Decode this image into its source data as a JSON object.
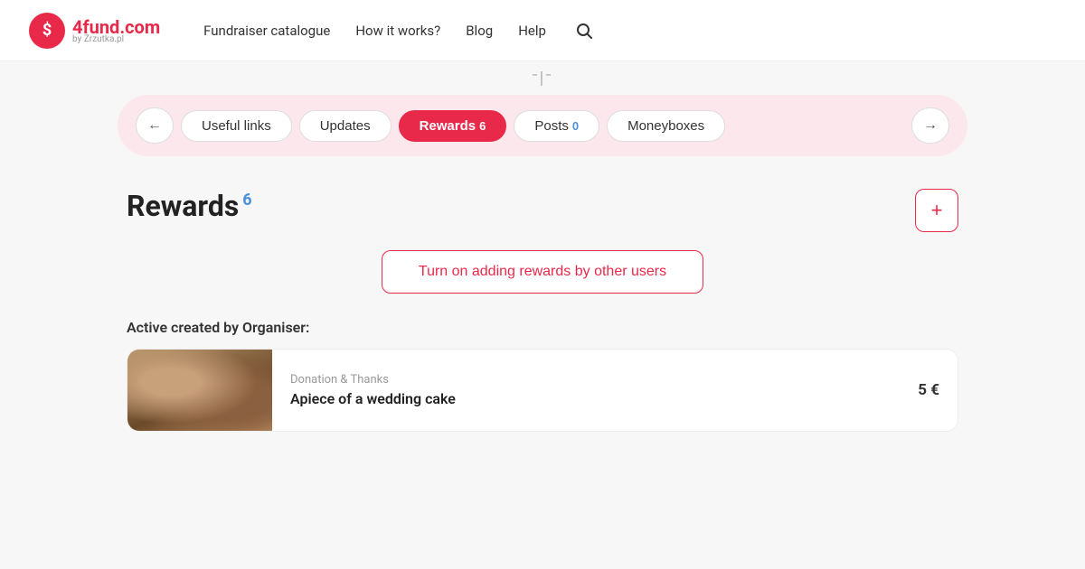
{
  "header": {
    "logo_text": "4fund",
    "logo_tld": ".com",
    "logo_sub": "by Zrzutka.pl",
    "nav_items": [
      "Fundraiser catalogue",
      "How it works?",
      "Blog",
      "Help"
    ]
  },
  "tabs": {
    "prev_label": "←",
    "next_label": "→",
    "items": [
      {
        "id": "useful-links",
        "label": "Useful links",
        "badge": null,
        "badge_type": null,
        "active": false
      },
      {
        "id": "updates",
        "label": "Updates",
        "badge": null,
        "badge_type": null,
        "active": false
      },
      {
        "id": "rewards",
        "label": "Rewards",
        "badge": "6",
        "badge_type": "white",
        "active": true
      },
      {
        "id": "posts",
        "label": "Posts",
        "badge": "0",
        "badge_type": "blue",
        "active": false
      },
      {
        "id": "moneyboxes",
        "label": "Moneyboxes",
        "badge": null,
        "badge_type": null,
        "active": false
      }
    ]
  },
  "rewards_section": {
    "title": "Rewards",
    "count": "6",
    "add_label": "+",
    "turn_on_label": "Turn on adding rewards by other users",
    "active_section_label": "Active created by Organiser:",
    "card": {
      "category": "Donation & Thanks",
      "title": "Apiece of a wedding cake",
      "price": "5 €"
    }
  }
}
